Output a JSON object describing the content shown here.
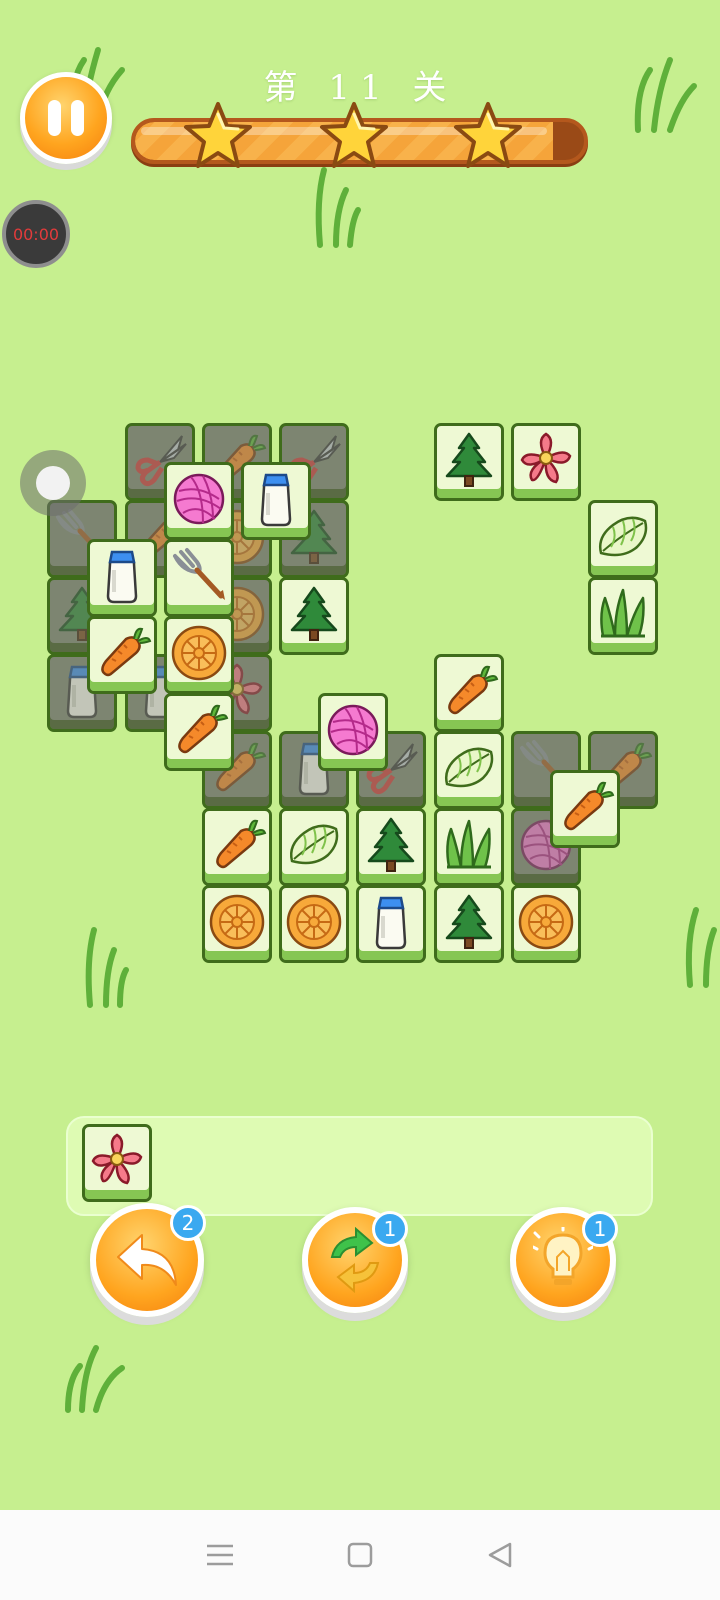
{
  "header": {
    "level_title": "第 11 关",
    "progress_fraction": 0.93,
    "stars": 3
  },
  "timer": {
    "text": "00:00"
  },
  "board_tiles": [
    {
      "icon": "shears",
      "covered": true
    },
    {
      "icon": "carrot",
      "covered": true
    },
    {
      "icon": "shears",
      "covered": true
    },
    {
      "icon": "fork",
      "covered": true
    },
    {
      "icon": "carrot",
      "covered": true
    },
    {
      "icon": "mooncake",
      "covered": true
    },
    {
      "icon": "tree",
      "covered": true
    },
    {
      "icon": "tree",
      "covered": true
    },
    {
      "icon": "mooncake",
      "covered": true
    },
    {
      "icon": "milk",
      "covered": true
    },
    {
      "icon": "milk",
      "covered": true
    },
    {
      "icon": "flower",
      "covered": true
    },
    {
      "icon": "carrot",
      "covered": true
    },
    {
      "icon": "yarn",
      "covered": false
    },
    {
      "icon": "milk",
      "covered": false
    },
    {
      "icon": "milk",
      "covered": false
    },
    {
      "icon": "fork",
      "covered": false
    },
    {
      "icon": "tree",
      "covered": false
    },
    {
      "icon": "carrot",
      "covered": false
    },
    {
      "icon": "mooncake",
      "covered": false
    },
    {
      "icon": "carrot",
      "covered": false
    },
    {
      "icon": "tree",
      "covered": false
    },
    {
      "icon": "flower",
      "covered": false
    },
    {
      "icon": "cabbage",
      "covered": false
    },
    {
      "icon": "grass",
      "covered": false
    },
    {
      "icon": "carrot",
      "covered": false
    },
    {
      "icon": "milk",
      "covered": true
    },
    {
      "icon": "shears",
      "covered": true
    },
    {
      "icon": "yarn",
      "covered": false
    },
    {
      "icon": "cabbage",
      "covered": false
    },
    {
      "icon": "fork",
      "covered": true
    },
    {
      "icon": "carrot",
      "covered": true
    },
    {
      "icon": "yarn",
      "covered": true
    },
    {
      "icon": "carrot",
      "covered": false
    },
    {
      "icon": "carrot",
      "covered": false
    },
    {
      "icon": "cabbage",
      "covered": false
    },
    {
      "icon": "tree",
      "covered": false
    },
    {
      "icon": "grass",
      "covered": false
    },
    {
      "icon": "mooncake",
      "covered": false
    },
    {
      "icon": "mooncake",
      "covered": false
    },
    {
      "icon": "milk",
      "covered": false
    },
    {
      "icon": "tree",
      "covered": false
    },
    {
      "icon": "mooncake",
      "covered": false
    }
  ],
  "tray": {
    "tiles": [
      {
        "icon": "flower"
      }
    ]
  },
  "powerups": [
    {
      "name": "undo",
      "count": "2",
      "icon": "undo-arrow-icon"
    },
    {
      "name": "shuffle",
      "count": "1",
      "icon": "shuffle-icon"
    },
    {
      "name": "hint",
      "count": "1",
      "icon": "lightbulb-icon"
    }
  ],
  "navbar": {
    "buttons": [
      "menu-icon",
      "home-icon",
      "back-icon"
    ]
  },
  "colors": {
    "background": "#c6ef8f",
    "tile_face": "#eef9d4",
    "tile_border": "#3f6c1b",
    "accent_orange": "#ffa51f",
    "badge_blue": "#3aa9f0"
  }
}
